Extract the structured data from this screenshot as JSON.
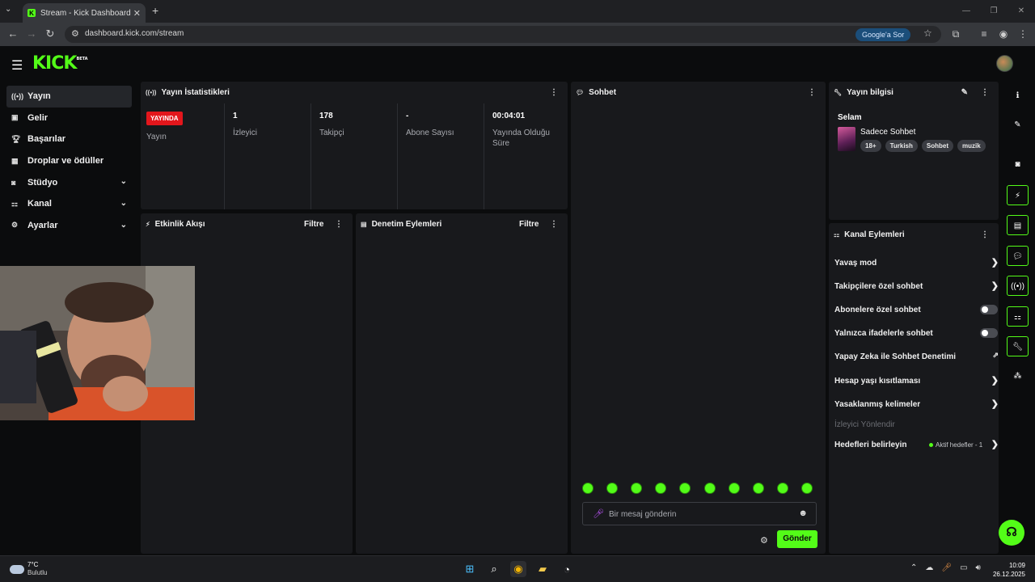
{
  "browser": {
    "tab_title": "Stream - Kick Dashboard",
    "url": "dashboard.kick.com/stream",
    "google_button": "Google'a Sor"
  },
  "brand": {
    "logo": "KICK",
    "beta": "BETA",
    "accent": "#53fc18"
  },
  "sidebar": {
    "items": [
      {
        "label": "Yayın",
        "icon": "broadcast-icon"
      },
      {
        "label": "Gelir",
        "icon": "revenue-icon"
      },
      {
        "label": "Başarılar",
        "icon": "trophy-icon"
      },
      {
        "label": "Droplar ve ödüller",
        "icon": "gift-icon"
      },
      {
        "label": "Stüdyo",
        "icon": "studio-icon"
      },
      {
        "label": "Kanal",
        "icon": "channel-icon"
      },
      {
        "label": "Ayarlar",
        "icon": "gear-icon"
      }
    ]
  },
  "stats": {
    "title": "Yayın İstatistikleri",
    "status_badge": "YAYINDA",
    "status_label": "Yayın",
    "viewers_value": "1",
    "viewers_label": "İzleyici",
    "followers_value": "178",
    "followers_label": "Takipçi",
    "subs_value": "-",
    "subs_label": "Abone Sayısı",
    "uptime_value": "00:04:01",
    "uptime_label": "Yayında Olduğu Süre"
  },
  "activity": {
    "title": "Etkinlik Akışı",
    "filter": "Filtre"
  },
  "moderation": {
    "title": "Denetim Eylemleri",
    "filter": "Filtre"
  },
  "chat": {
    "title": "Sohbet",
    "placeholder": "Bir mesaj gönderin",
    "send": "Gönder"
  },
  "stream_info": {
    "title": "Yayın bilgisi",
    "greeting": "Selam",
    "stream_title": "Sadece Sohbet",
    "tags": [
      "18+",
      "Turkish",
      "Sohbet",
      "muzik"
    ]
  },
  "channel_actions": {
    "title": "Kanal Eylemleri",
    "slow_mode": "Yavaş mod",
    "followers_only": "Takipçilere özel sohbet",
    "subs_only": "Abonelere özel sohbet",
    "emotes_only": "Yalnızca ifadelerle sohbet",
    "ai_moderation": "Yapay Zeka ile Sohbet Denetimi",
    "account_age": "Hesap yaşı kısıtlaması",
    "banned_words": "Yasaklanmış kelimeler",
    "raid": "İzleyici Yönlendir",
    "goals": "Hedefleri belirleyin",
    "goals_status": "Aktif hedefler - 1",
    "subs_only_enabled": false,
    "emotes_only_enabled": false
  },
  "taskbar": {
    "temp": "7°C",
    "condition": "Bulutlu",
    "time": "10:09",
    "date": "26.12.2025"
  }
}
